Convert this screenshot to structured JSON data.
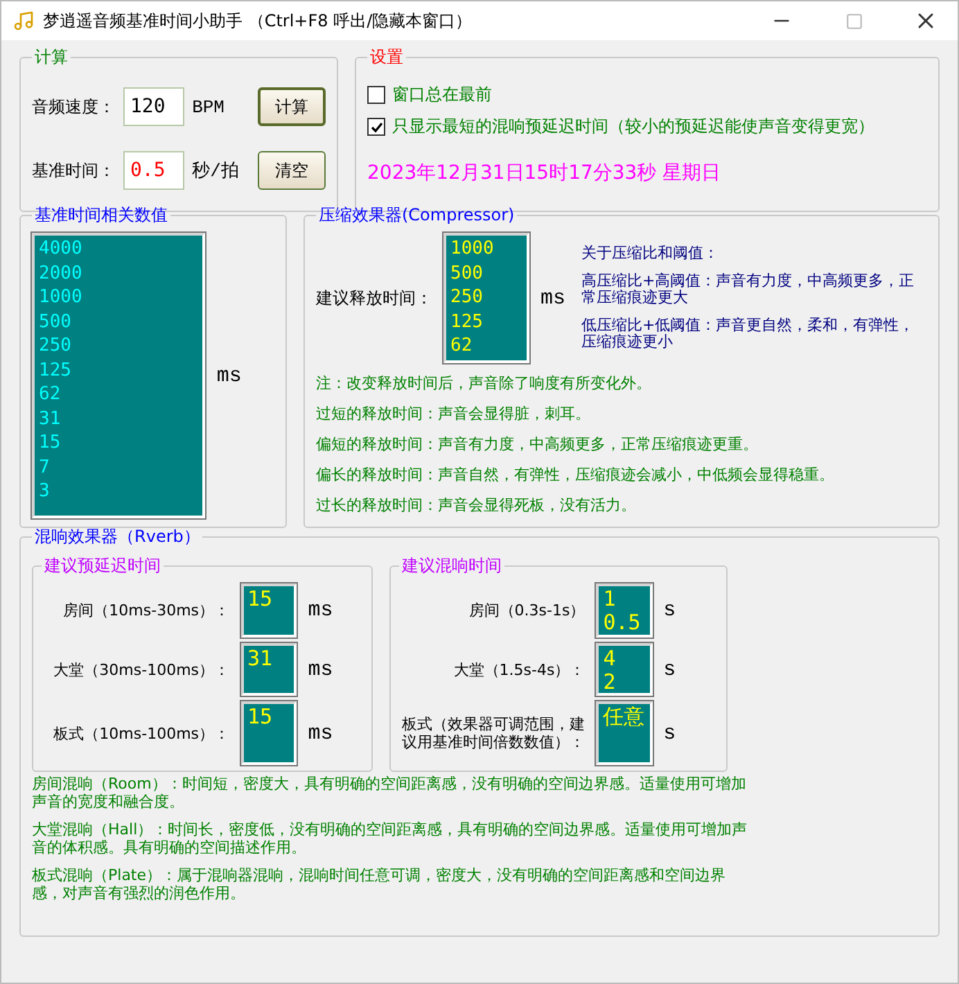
{
  "window": {
    "title": "梦逍遥音频基准时间小助手 （Ctrl+F8 呼出/隐藏本窗口）"
  },
  "calc": {
    "title": "计算",
    "fields": [
      {
        "label": "音频速度：",
        "value": "120",
        "unit": "BPM",
        "button": "计算",
        "focused": true,
        "kind": "input"
      },
      {
        "label": "基准时间：",
        "value": "0.5",
        "unit": "秒/拍",
        "button": "清空",
        "focused": false,
        "kind": "result"
      }
    ]
  },
  "settings": {
    "title": "设置",
    "options": [
      {
        "label": "窗口总在最前",
        "checked": false
      },
      {
        "label": "只显示最短的混响预延迟时间（较小的预延迟能使声音变得更宽）",
        "checked": true
      }
    ],
    "datetime": "2023年12月31日15时17分33秒  星期日"
  },
  "base_values": {
    "title": "基准时间相关数值",
    "values": [
      "4000",
      "2000",
      "1000",
      "500",
      "250",
      "125",
      "62",
      "31",
      "15",
      "7",
      "3"
    ],
    "unit": "ms"
  },
  "compressor": {
    "title": "压缩效果器(Compressor)",
    "release_label": "建议释放时间：",
    "values": [
      "1000",
      "500",
      "250",
      "125",
      "62"
    ],
    "unit": "ms",
    "about_title": "关于压缩比和阈值：",
    "about": [
      "高压缩比+高阈值：声音有力度，中高频更多，正常压缩痕迹更大",
      "低压缩比+低阈值：声音更自然，柔和，有弹性，压缩痕迹更小"
    ],
    "notes": [
      "注：改变释放时间后，声音除了响度有所变化外。",
      "过短的释放时间：声音会显得脏，刺耳。",
      "偏短的释放时间：声音有力度，中高频更多，正常压缩痕迹更重。",
      "偏长的释放时间：声音自然，有弹性，压缩痕迹会减小，中低频会显得稳重。",
      "过长的释放时间：声音会显得死板，没有活力。"
    ]
  },
  "reverb": {
    "title": "混响效果器（Rverb）",
    "predelay": {
      "title": "建议预延迟时间",
      "rows": [
        {
          "label": "房间（10ms-30ms）：",
          "values": [
            "15"
          ],
          "unit": "ms"
        },
        {
          "label": "大堂（30ms-100ms）：",
          "values": [
            "31"
          ],
          "unit": "ms"
        },
        {
          "label": "板式（10ms-100ms）：",
          "values": [
            "15"
          ],
          "unit": "ms"
        }
      ]
    },
    "reverb_time": {
      "title": "建议混响时间",
      "rows": [
        {
          "label": "房间（0.3s-1s）",
          "values": [
            "1",
            "0.5"
          ],
          "unit": "s"
        },
        {
          "label": "大堂（1.5s-4s）：",
          "values": [
            "4",
            "2"
          ],
          "unit": "s"
        },
        {
          "label": "板式（效果器可调范围，建议用基准时间倍数数值）：",
          "values": [
            "任意"
          ],
          "unit": "s"
        }
      ]
    },
    "descriptions": [
      "房间混响（Room）：时间短，密度大，具有明确的空间距离感，没有明确的空间边界感。适量使用可增加声音的宽度和融合度。",
      "大堂混响（Hall）：时间长，密度低，没有明确的空间距离感，具有明确的空间边界感。适量使用可增加声音的体积感。具有明确的空间描述作用。",
      "板式混响（Plate）：属于混响器混响，混响时间任意可调，密度大，没有明确的空间距离感和空间边界感，对声音有强烈的润色作用。"
    ]
  }
}
